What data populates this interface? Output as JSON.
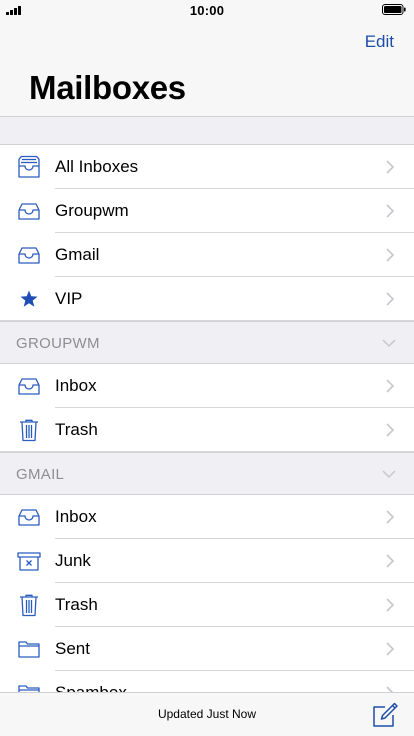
{
  "status_bar": {
    "time": "10:00"
  },
  "nav": {
    "edit_label": "Edit",
    "title": "Mailboxes"
  },
  "main_section": [
    {
      "label": "All Inboxes",
      "icon": "all-inboxes-icon"
    },
    {
      "label": "Groupwm",
      "icon": "inbox-icon"
    },
    {
      "label": "Gmail",
      "icon": "inbox-icon"
    },
    {
      "label": "VIP",
      "icon": "star-icon"
    }
  ],
  "groupwm": {
    "header": "GROUPWM",
    "items": [
      {
        "label": "Inbox",
        "icon": "inbox-icon"
      },
      {
        "label": "Trash",
        "icon": "trash-icon"
      }
    ]
  },
  "gmail": {
    "header": "GMAIL",
    "items": [
      {
        "label": "Inbox",
        "icon": "inbox-icon"
      },
      {
        "label": "Junk",
        "icon": "junk-icon"
      },
      {
        "label": "Trash",
        "icon": "trash-icon"
      },
      {
        "label": "Sent",
        "icon": "folder-icon"
      },
      {
        "label": "Spambox",
        "icon": "folder-icon"
      }
    ]
  },
  "toolbar": {
    "status": "Updated Just Now"
  },
  "colors": {
    "accent": "#1e4ea8",
    "icon": "#2a5cbf",
    "star": "#1f4fb5",
    "chevron": "#c7c7cc"
  }
}
